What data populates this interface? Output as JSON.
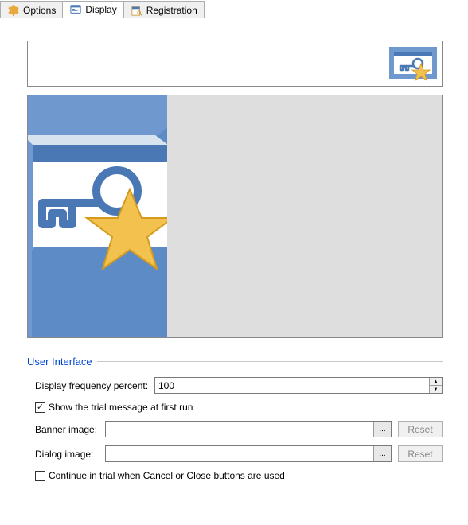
{
  "tabs": {
    "options": "Options",
    "display": "Display",
    "registration": "Registration"
  },
  "group": {
    "title": "User Interface",
    "freq_label": "Display frequency percent:",
    "freq_value": "100",
    "show_trial_label": "Show the trial message at first run",
    "show_trial_checked": true,
    "banner_label": "Banner image:",
    "banner_value": "",
    "dialog_label": "Dialog image:",
    "dialog_value": "",
    "browse_label": "...",
    "reset_label": "Reset",
    "continue_trial_label": "Continue in trial when Cancel or Close buttons are used",
    "continue_trial_checked": false
  },
  "icons": {
    "gear": "gear-icon",
    "display": "display-icon",
    "registration": "registration-icon",
    "key_star": "key-star-icon"
  }
}
